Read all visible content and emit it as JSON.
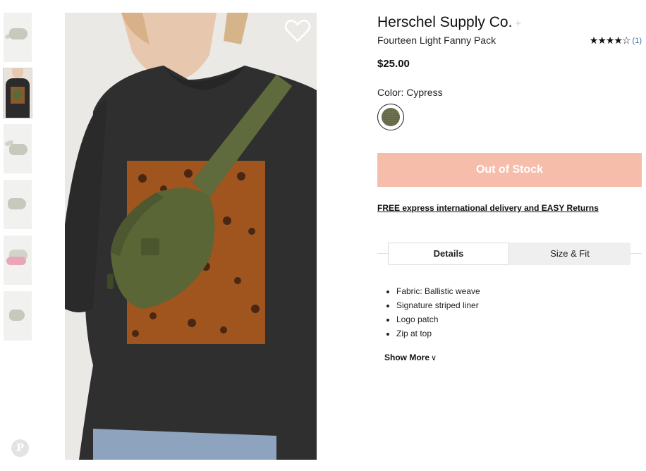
{
  "product": {
    "brand": "Herschel Supply Co.",
    "brand_follow": "+",
    "name": "Fourteen Light Fanny Pack",
    "rating_stars": "★★★★☆",
    "rating_value": 4,
    "rating_count": "(1)",
    "price": "$25.00",
    "color_label": "Color: Cypress",
    "color_hex": "#6f7352"
  },
  "actions": {
    "stock_button": "Out of Stock",
    "delivery_link": "FREE express international delivery and EASY Returns",
    "show_more": "Show More",
    "show_more_icon": "chevron-down-icon",
    "favorite_icon": "heart-outline-icon",
    "pinterest_icon": "pinterest-icon",
    "pinterest_glyph": "P"
  },
  "tabs": [
    {
      "label": "Details",
      "active": true
    },
    {
      "label": "Size & Fit",
      "active": false
    }
  ],
  "details": [
    "Fabric: Ballistic weave",
    "Signature striped liner",
    "Logo patch",
    "Zip at top"
  ],
  "colors": {
    "out_of_stock_bg": "#f6bdaa",
    "link_blue": "#3a6ea5"
  }
}
